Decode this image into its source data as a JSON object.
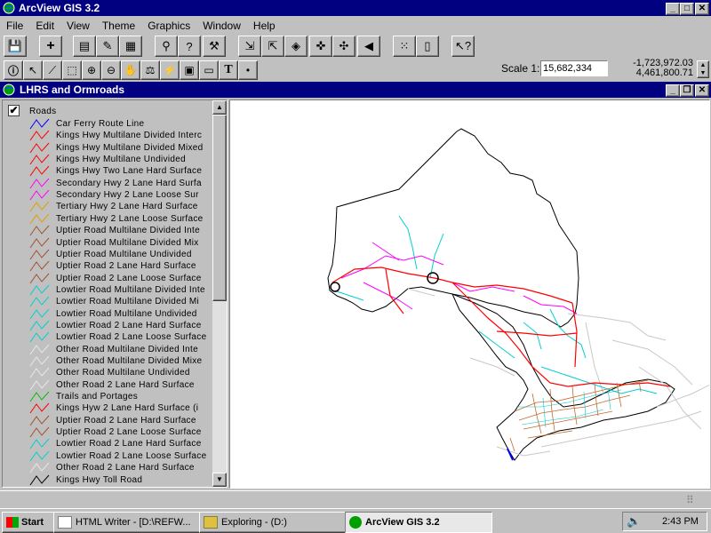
{
  "app": {
    "title": "ArcView GIS 3.2"
  },
  "menubar": [
    "File",
    "Edit",
    "View",
    "Theme",
    "Graphics",
    "Window",
    "Help"
  ],
  "scale": {
    "label": "Scale 1:",
    "value": "15,682,334"
  },
  "coords": {
    "x": "-1,723,972.03",
    "y": "4,461,800.71"
  },
  "view_window": {
    "title": "LHRS and Ormroads"
  },
  "toc": {
    "theme_name": "Roads",
    "entries": [
      {
        "label": "Car Ferry Route Line",
        "color": "#0000ff"
      },
      {
        "label": "Kings Hwy Multilane Divided Interc",
        "color": "#ff0000"
      },
      {
        "label": "Kings Hwy Multilane Divided Mixed",
        "color": "#ff0000"
      },
      {
        "label": "Kings Hwy Multilane Undivided",
        "color": "#ff0000"
      },
      {
        "label": "Kings Hwy Two Lane Hard Surface",
        "color": "#ff0000"
      },
      {
        "label": "Secondary Hwy 2 Lane Hard Surfa",
        "color": "#ff00ff"
      },
      {
        "label": "Secondary Hwy 2 Lane Loose Sur",
        "color": "#ff00ff"
      },
      {
        "label": "Tertiary Hwy 2 Lane Hard Surface",
        "color": "#e0a000"
      },
      {
        "label": "Tertiary Hwy 2 Lane Loose Surface",
        "color": "#e0a000"
      },
      {
        "label": "Uptier Road Multilane Divided Inte",
        "color": "#a0522d"
      },
      {
        "label": "Uptier Road Multilane Divided Mix",
        "color": "#a0522d"
      },
      {
        "label": "Uptier Road Multilane Undivided",
        "color": "#a0522d"
      },
      {
        "label": "Uptier Road 2 Lane Hard Surface",
        "color": "#a0522d"
      },
      {
        "label": "Uptier Road 2 Lane Loose Surface",
        "color": "#a0522d"
      },
      {
        "label": "Lowtier Road Multilane Divided Inte",
        "color": "#00d0d0"
      },
      {
        "label": "Lowtier Road Multilane Divided Mi",
        "color": "#00d0d0"
      },
      {
        "label": "Lowtier Road Multilane Undivided",
        "color": "#00d0d0"
      },
      {
        "label": "Lowtier Road 2 Lane Hard Surface",
        "color": "#00d0d0"
      },
      {
        "label": "Lowtier Road 2 Lane Loose Surface",
        "color": "#00d0d0"
      },
      {
        "label": "Other Road Multilane Divided Inte",
        "color": "#e8e8e8"
      },
      {
        "label": "Other Road Multilane Divided Mixe",
        "color": "#e8e8e8"
      },
      {
        "label": "Other Road Multilane Undivided",
        "color": "#e8e8e8"
      },
      {
        "label": "Other Road 2 Lane Hard Surface",
        "color": "#e8e8e8"
      },
      {
        "label": "Trails and Portages",
        "color": "#00c000"
      },
      {
        "label": "Kings Hyw 2 Lane Hard Surface (i",
        "color": "#ff0000"
      },
      {
        "label": "Uptier Road 2 Lane Hard Surface",
        "color": "#a0522d"
      },
      {
        "label": "Uptier Road 2 Lane Loose Surface",
        "color": "#a0522d"
      },
      {
        "label": "Lowtier Road 2 Lane Hard Surface",
        "color": "#00d0d0"
      },
      {
        "label": "Lowtier Road 2 Lane Loose Surface",
        "color": "#00d0d0"
      },
      {
        "label": "Other Road 2 Lane Hard Surface",
        "color": "#e8e8e8"
      },
      {
        "label": "Kings Hwy Toll Road",
        "color": "#000000"
      }
    ]
  },
  "taskbar": {
    "start": "Start",
    "items": [
      "HTML Writer - [D:\\REFW...",
      "Exploring - (D:)",
      "ArcView GIS 3.2"
    ],
    "clock": "2:43 PM"
  }
}
